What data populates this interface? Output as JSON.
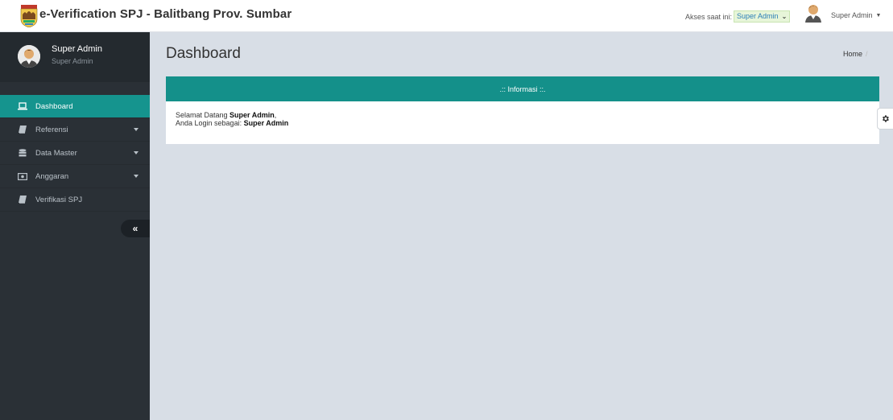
{
  "app": {
    "title": "e-Verification SPJ - Balitbang Prov. Sumbar"
  },
  "topbar": {
    "access_label": "Akses saat ini:",
    "access_value": "Super Admin",
    "user_name": "Super Admin"
  },
  "sidebar": {
    "profile_name": "Super Admin",
    "profile_role": "Super Admin",
    "items": [
      {
        "label": "Dashboard",
        "icon": "laptop-icon",
        "active": true,
        "has_submenu": false
      },
      {
        "label": "Referensi",
        "icon": "book-icon",
        "active": false,
        "has_submenu": true
      },
      {
        "label": "Data Master",
        "icon": "database-icon",
        "active": false,
        "has_submenu": true
      },
      {
        "label": "Anggaran",
        "icon": "money-icon",
        "active": false,
        "has_submenu": true
      },
      {
        "label": "Verifikasi SPJ",
        "icon": "book-icon",
        "active": false,
        "has_submenu": false
      }
    ],
    "collapse_label": "«"
  },
  "main": {
    "page_title": "Dashboard",
    "breadcrumb": [
      "Home"
    ],
    "panel": {
      "heading": ".:: Informasi ::.",
      "welcome_prefix": "Selamat Datang ",
      "welcome_name": "Super Admin",
      "welcome_suffix": ",",
      "login_prefix": "Anda Login sebagai: ",
      "login_role": "Super Admin"
    }
  },
  "colors": {
    "accent": "#15948e",
    "sidebar_bg": "#2a3036",
    "content_bg": "#d8dee6",
    "access_select_bg": "#e7f5d9"
  }
}
